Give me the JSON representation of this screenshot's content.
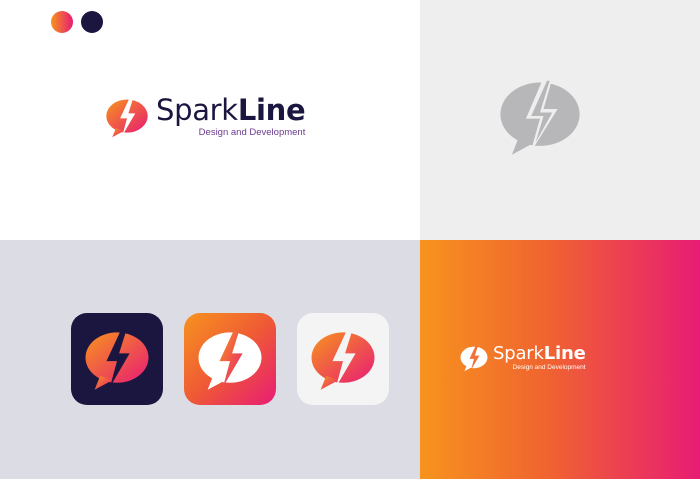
{
  "brand": {
    "name_part1": "Spark",
    "name_part2": "Line",
    "tagline": "Design and Development"
  },
  "colors": {
    "gradient_start": "#f7931e",
    "gradient_end": "#e81c74",
    "navy": "#1b1640",
    "mono_gray": "#b7b7b9",
    "icon_panel_bg": "#dcdce5",
    "light_tile": "#f4f4f4"
  },
  "palette_swatches": [
    "orange-to-pink-gradient",
    "navy"
  ],
  "icons": {
    "mark": "speech-bubble-lightning-bolt-icon",
    "app_icon_variants": [
      "dark",
      "gradient",
      "light"
    ]
  }
}
